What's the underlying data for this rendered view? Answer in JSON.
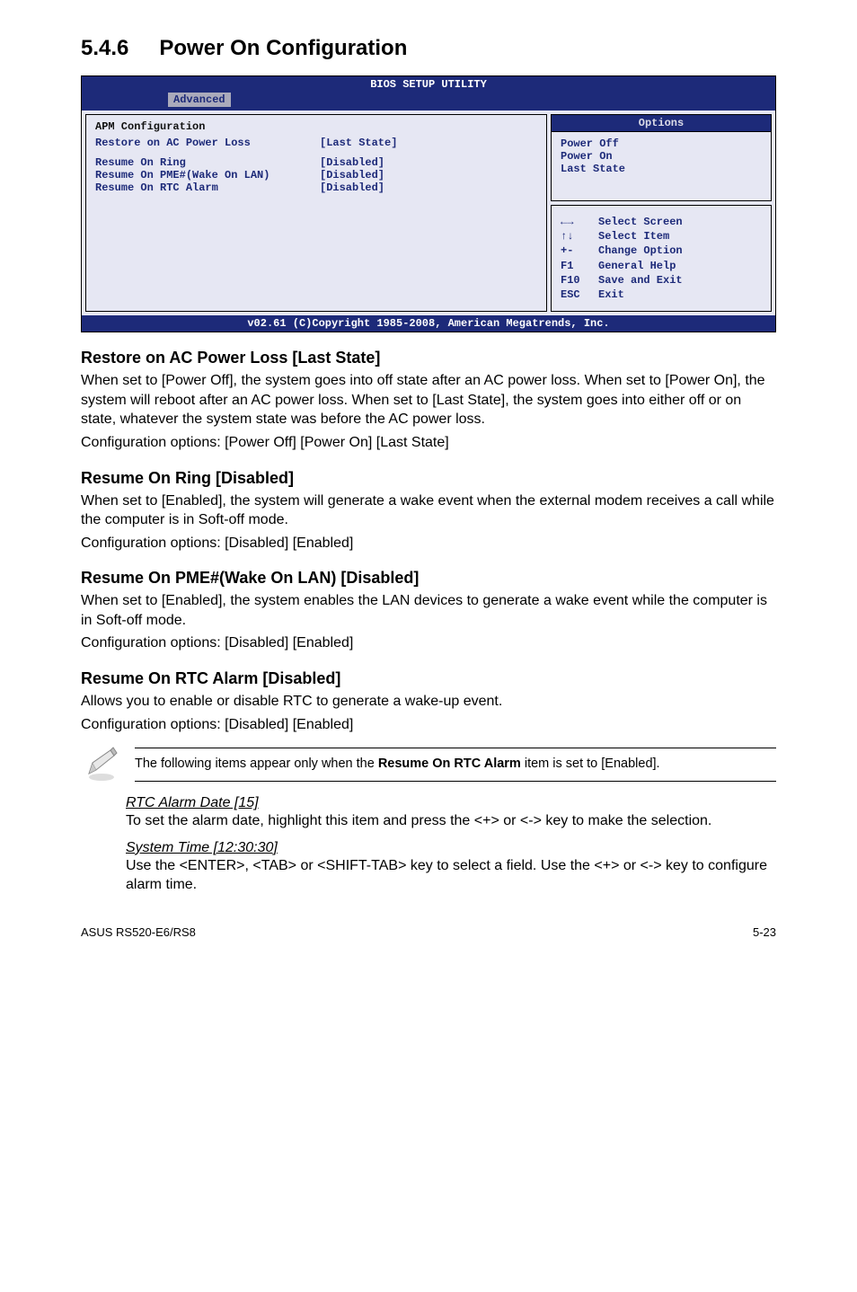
{
  "section_no": "5.4.6",
  "section_title": "Power On Configuration",
  "bios": {
    "title": "BIOS SETUP UTILITY",
    "tab": "Advanced",
    "cfg_heading": "APM Configuration",
    "items": [
      {
        "label": "Restore on AC Power Loss",
        "value": "[Last State]"
      },
      {
        "label": "Resume On Ring",
        "value": "[Disabled]"
      },
      {
        "label": "Resume On PME#(Wake On LAN)",
        "value": "[Disabled]"
      },
      {
        "label": "Resume On RTC Alarm",
        "value": "[Disabled]"
      }
    ],
    "options_title": "Options",
    "options": [
      "Power Off",
      "Power On",
      "Last State"
    ],
    "help": [
      {
        "k": "←→",
        "t": "Select Screen"
      },
      {
        "k": "↑↓",
        "t": "Select Item"
      },
      {
        "k": "+-",
        "t": "Change Option"
      },
      {
        "k": "F1",
        "t": "General Help"
      },
      {
        "k": "F10",
        "t": "Save and Exit"
      },
      {
        "k": "ESC",
        "t": "Exit"
      }
    ],
    "footer": "v02.61 (C)Copyright 1985-2008, American Megatrends, Inc."
  },
  "s1": {
    "h": "Restore on AC Power Loss [Last State]",
    "p": "When set to [Power Off], the system goes into off state after an AC power loss. When set to [Power On], the system will reboot after an AC power loss. When set to [Last State], the system goes into either off or on state, whatever the system state was before the AC power loss.",
    "opts": "Configuration options: [Power Off] [Power On] [Last State]"
  },
  "s2": {
    "h": "Resume On Ring [Disabled]",
    "p": "When set to [Enabled], the system will generate a wake event when the external modem receives a call while the computer is in Soft-off mode.",
    "opts": "Configuration options: [Disabled] [Enabled]"
  },
  "s3": {
    "h": "Resume On PME#(Wake On LAN) [Disabled]",
    "p": "When set to [Enabled], the system enables the LAN devices to generate a wake event while the computer is in Soft-off mode.",
    "opts": "Configuration options: [Disabled] [Enabled]"
  },
  "s4": {
    "h": "Resume On RTC Alarm [Disabled]",
    "p": "Allows you to enable or disable RTC to generate a wake-up event.",
    "opts": "Configuration options: [Disabled] [Enabled]"
  },
  "note_prefix": "The following items appear only when the ",
  "note_bold": "Resume On RTC Alarm",
  "note_suffix": " item is set to [Enabled].",
  "rtc": {
    "title": "RTC Alarm Date [15]",
    "text": "To set the alarm date, highlight this item and press the <+> or <-> key to make the selection."
  },
  "systime": {
    "title": "System Time [12:30:30]",
    "text": "Use the <ENTER>, <TAB> or <SHIFT-TAB> key to select a field. Use the <+> or <-> key to configure alarm time."
  },
  "footer_left": "ASUS RS520-E6/RS8",
  "footer_right": "5-23"
}
